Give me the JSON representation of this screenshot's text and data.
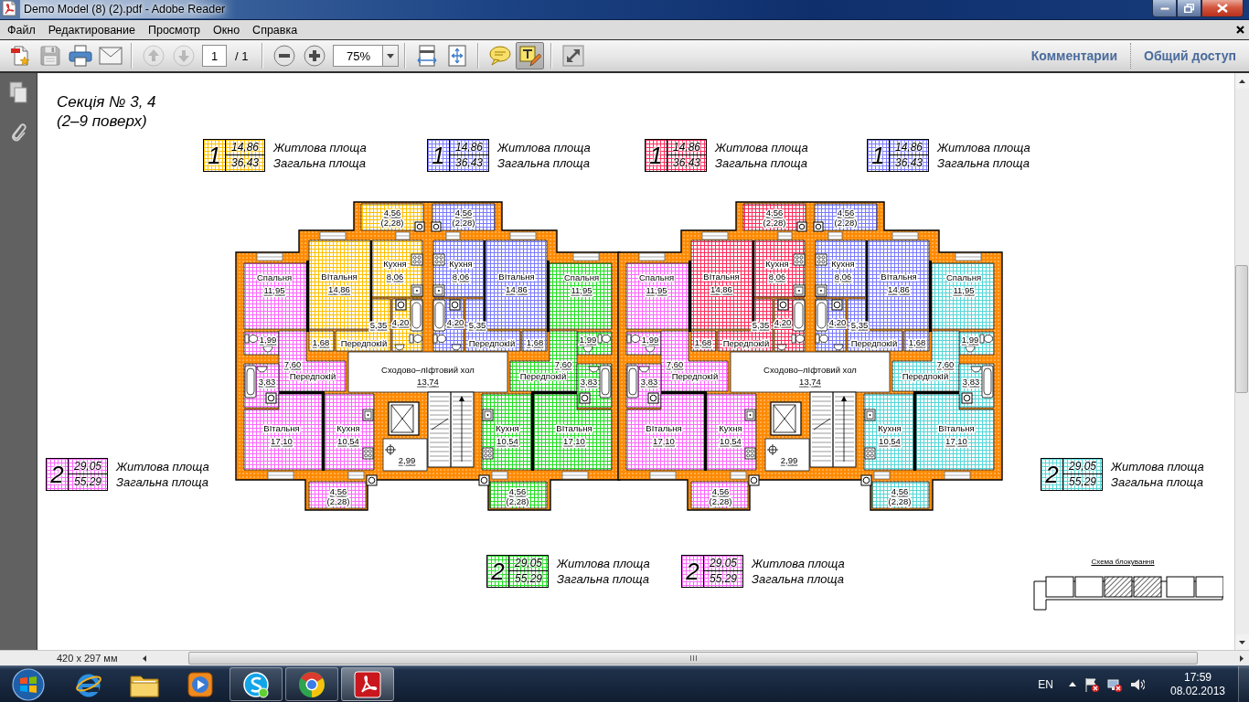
{
  "window": {
    "title": "Demo Model (8) (2).pdf - Adobe Reader"
  },
  "menu": [
    "Файл",
    "Редактирование",
    "Просмотр",
    "Окно",
    "Справка"
  ],
  "toolbar": {
    "groups": [
      [
        {
          "kind": "create",
          "disabled": false,
          "selected": false
        },
        {
          "kind": "save",
          "disabled": true,
          "selected": false
        },
        {
          "kind": "print",
          "disabled": false,
          "selected": false
        },
        {
          "kind": "email",
          "disabled": false,
          "selected": false
        }
      ],
      [
        {
          "kind": "prev_page",
          "disabled": true,
          "selected": false
        },
        {
          "kind": "next_page",
          "disabled": true,
          "selected": false
        },
        {
          "kind": "page_field",
          "value": "1",
          "total": "/ 1"
        }
      ],
      [
        {
          "kind": "zoom_out",
          "disabled": false,
          "selected": false
        },
        {
          "kind": "zoom_in",
          "disabled": false,
          "selected": false
        },
        {
          "kind": "zoom_field",
          "value": "75%"
        }
      ],
      [
        {
          "kind": "fit_width",
          "disabled": false,
          "selected": false
        },
        {
          "kind": "fit_page",
          "disabled": false,
          "selected": false
        }
      ],
      [
        {
          "kind": "comment",
          "disabled": false,
          "selected": false
        },
        {
          "kind": "highlight",
          "disabled": false,
          "selected": true
        }
      ],
      [
        {
          "kind": "full_screen",
          "disabled": false,
          "selected": false
        }
      ]
    ],
    "links": [
      "Комментарии",
      "Общий доступ"
    ]
  },
  "document": {
    "title_lines": [
      "Секція № 3, 4",
      "(2–9 поверх)"
    ],
    "legends_top": [
      {
        "number": "1",
        "living_area": "14,86",
        "total_area": "36,43",
        "living_label": "Житлова площа",
        "total_label": "Загальна площа",
        "color": "#ffc000"
      },
      {
        "number": "1",
        "living_area": "14,86",
        "total_area": "36,43",
        "living_label": "Житлова площа",
        "total_label": "Загальна площа",
        "color": "#7a7aff"
      },
      {
        "number": "1",
        "living_area": "14,86",
        "total_area": "36,43",
        "living_label": "Житлова площа",
        "total_label": "Загальна площа",
        "color": "#ff2a5a"
      },
      {
        "number": "1",
        "living_area": "14,86",
        "total_area": "36,43",
        "living_label": "Житлова площа",
        "total_label": "Загальна площа",
        "color": "#7a7aff"
      }
    ],
    "legend_left": {
      "number": "2",
      "living_area": "29,05",
      "total_area": "55,29",
      "living_label": "Житлова площа",
      "total_label": "Загальна площа",
      "color": "#ff66ff"
    },
    "floor_plan": {
      "sections": [
        {
          "apartments": [
            {
              "color": "#ff66ff",
              "rooms": [
                {
                  "name": "Спальня",
                  "area": "11,95"
                },
                {
                  "area": "1,99"
                },
                {
                  "name": "ПередпокІй",
                  "area": "7,60"
                },
                {
                  "area": "3,83"
                },
                {
                  "name": "ВІтальня",
                  "area": "17,10"
                },
                {
                  "name": "Кухня",
                  "area": "10,54"
                },
                {
                  "area": "4,56",
                  "reduced_area": "(2,28)"
                }
              ]
            },
            {
              "color": "#ffc000",
              "rooms": [
                {
                  "area": "4,56",
                  "reduced_area": "(2,28)"
                },
                {
                  "name": "ВІтальня",
                  "area": "14,86"
                },
                {
                  "name": "Кухня",
                  "area": "8,06"
                },
                {
                  "area": "1,68"
                },
                {
                  "name": "ПередпокІй",
                  "area": "5,35"
                },
                {
                  "area": "4,20"
                }
              ]
            },
            {
              "color": "#7a7aff",
              "rooms": [
                {
                  "area": "4,56",
                  "reduced_area": "(2,28)"
                },
                {
                  "name": "Кухня",
                  "area": "8,06"
                },
                {
                  "name": "ВІтальня",
                  "area": "14,86"
                },
                {
                  "area": "4,20"
                },
                {
                  "name": "ПередпокІй",
                  "area": "5,35"
                },
                {
                  "area": "1,68"
                }
              ]
            },
            {
              "color": "#22dd22",
              "rooms": [
                {
                  "name": "Спальня",
                  "area": "11,95"
                },
                {
                  "area": "1,99"
                },
                {
                  "name": "ПередпокІй",
                  "area": "7,60"
                },
                {
                  "area": "3,83"
                },
                {
                  "name": "Кухня",
                  "area": "10,54"
                },
                {
                  "name": "ВІтальня",
                  "area": "17,10"
                },
                {
                  "area": "4,56",
                  "reduced_area": "(2,28)"
                }
              ]
            }
          ],
          "common_areas": [
            {
              "name": "Сходово–лІфтовий хол",
              "area": "13,74"
            },
            {
              "area": "2,99"
            }
          ]
        },
        {
          "apartments": [
            {
              "color": "#ff66ff",
              "rooms": [
                {
                  "name": "Спальня",
                  "area": "11,95"
                },
                {
                  "area": "1,99"
                },
                {
                  "name": "ПередпокІй",
                  "area": "7,60"
                },
                {
                  "area": "3,83"
                },
                {
                  "name": "ВІтальня",
                  "area": "17,10"
                },
                {
                  "name": "Кухня",
                  "area": "10,54"
                },
                {
                  "area": "4,56",
                  "reduced_area": "(2,28)"
                }
              ]
            },
            {
              "color": "#ff2a5a",
              "rooms": [
                {
                  "area": "4,56",
                  "reduced_area": "(2,28)"
                },
                {
                  "name": "ВІтальня",
                  "area": "14,86"
                },
                {
                  "name": "Кухня",
                  "area": "8,06"
                },
                {
                  "area": "1,68"
                },
                {
                  "name": "ПередпокІй",
                  "area": "5,35"
                },
                {
                  "area": "4,20"
                }
              ]
            },
            {
              "color": "#7a7aff",
              "rooms": [
                {
                  "area": "4,56",
                  "reduced_area": "(2,28)"
                },
                {
                  "name": "Кухня",
                  "area": "8,06"
                },
                {
                  "name": "ВІтальня",
                  "area": "14,86"
                },
                {
                  "area": "4,20"
                },
                {
                  "name": "ПередпокІй",
                  "area": "5,35"
                },
                {
                  "area": "1,68"
                }
              ]
            },
            {
              "color": "#55d6d6",
              "rooms": [
                {
                  "name": "Спальня",
                  "area": "11,95"
                },
                {
                  "area": "1,99"
                },
                {
                  "name": "ПередпокІй",
                  "area": "7,60"
                },
                {
                  "area": "3,83"
                },
                {
                  "name": "Кухня",
                  "area": "10,54"
                },
                {
                  "name": "ВІтальня",
                  "area": "17,10"
                },
                {
                  "area": "4,56",
                  "reduced_area": "(2,28)"
                }
              ]
            }
          ],
          "common_areas": [
            {
              "name": "Сходово–лІфтовий хол",
              "area": "13,74"
            },
            {
              "area": "2,99"
            }
          ]
        }
      ]
    },
    "legend_right": {
      "number": "2",
      "living_area": "29,05",
      "total_area": "55,29",
      "living_label": "Житлова площа",
      "total_label": "Загальна площа",
      "color": "#55d6d6"
    },
    "legends_bottom": [
      {
        "number": "2",
        "living_area": "29,05",
        "total_area": "55,29",
        "living_label": "Житлова площа",
        "total_label": "Загальна площа",
        "color": "#22dd22"
      },
      {
        "number": "2",
        "living_area": "29,05",
        "total_area": "55,29",
        "living_label": "Житлова площа",
        "total_label": "Загальна площа",
        "color": "#ff66ff"
      }
    ],
    "scheme": {
      "title": "Схема блокування"
    }
  },
  "status_bar": {
    "page_size": "420 x 297 мм"
  },
  "taskbar": {
    "apps": [
      {
        "kind": "browser_e",
        "running": false,
        "active": false
      },
      {
        "kind": "folder",
        "running": false,
        "active": false
      },
      {
        "kind": "player",
        "running": false,
        "active": false
      },
      {
        "kind": "chat",
        "running": true,
        "active": false
      },
      {
        "kind": "browser_ring",
        "running": true,
        "active": false
      },
      {
        "kind": "pdf",
        "running": true,
        "active": true
      }
    ],
    "tray": {
      "language": "EN",
      "time": "17:59",
      "date": "08.02.2013"
    }
  }
}
